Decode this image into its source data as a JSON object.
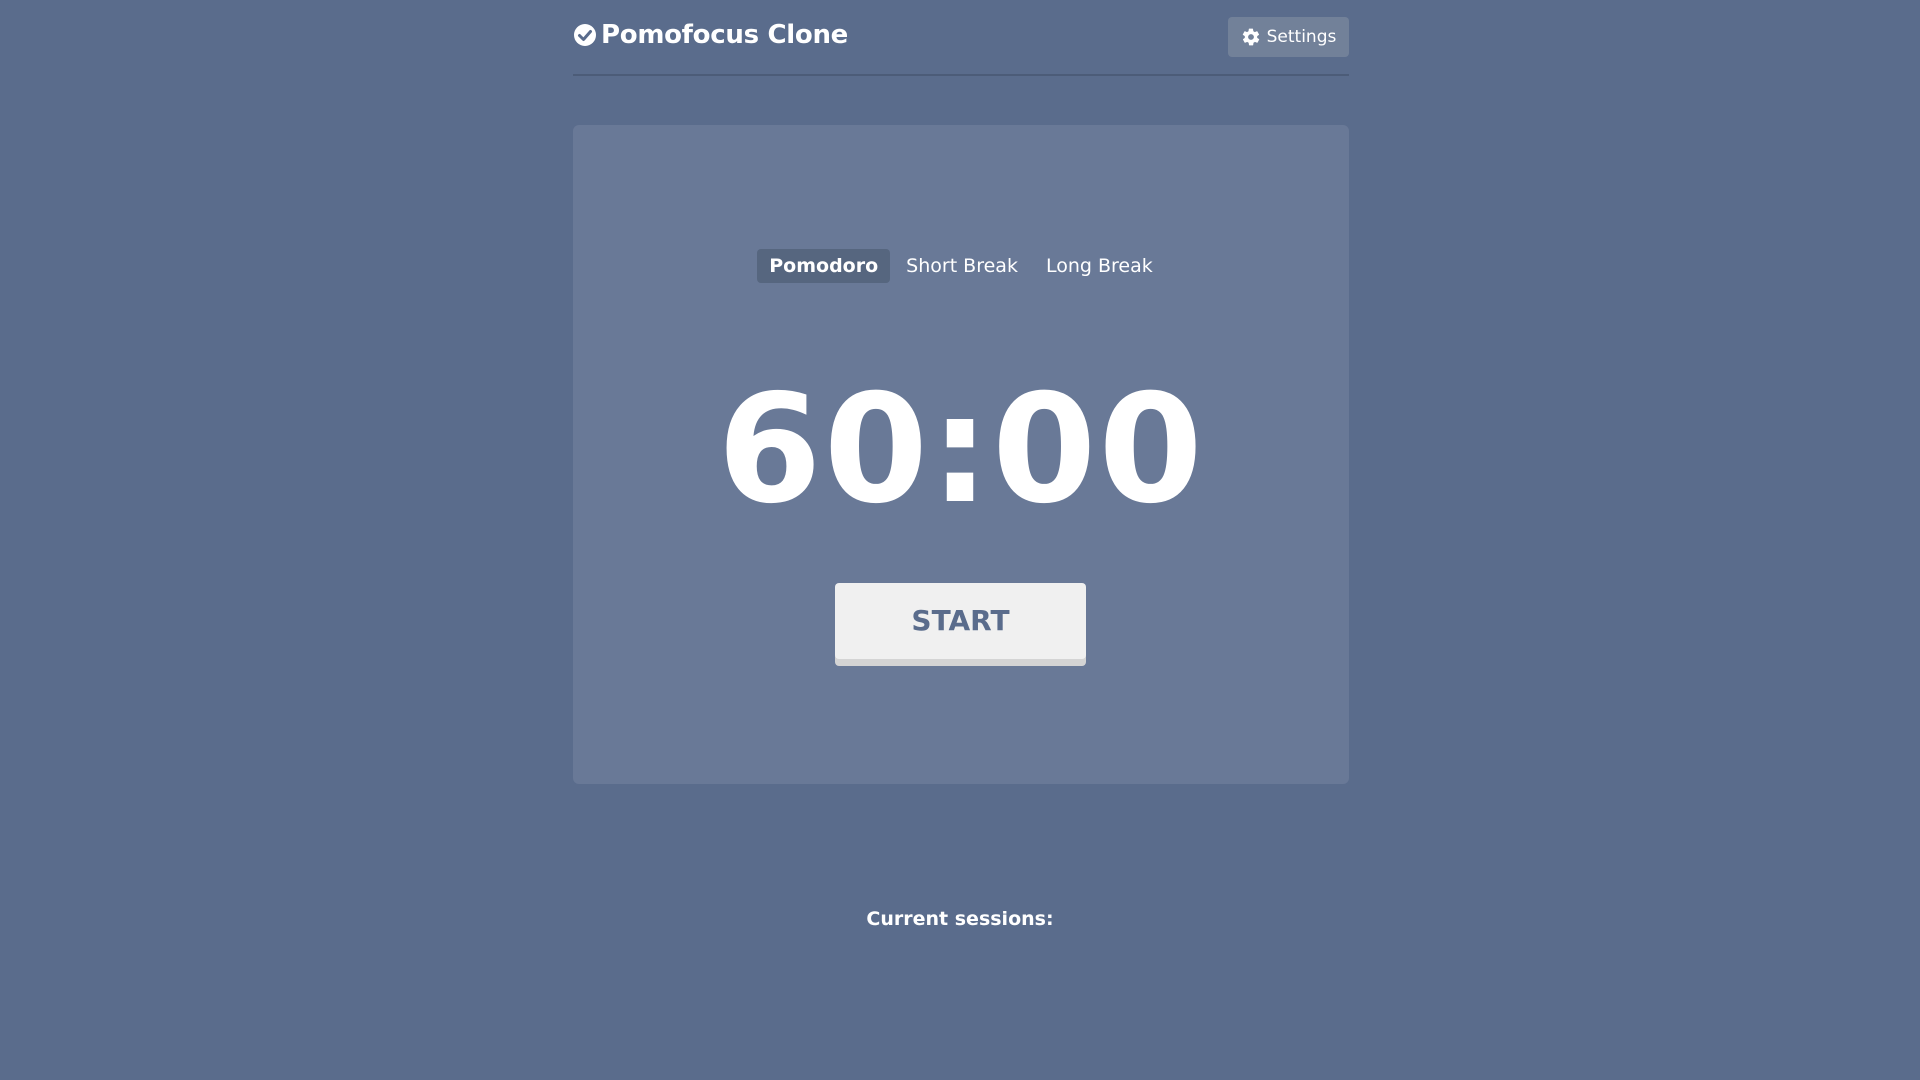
{
  "app": {
    "title": "Pomofocus Clone",
    "logo_icon": "check-circle-icon"
  },
  "header": {
    "settings_label": "Settings",
    "settings_icon": "gear-icon"
  },
  "tabs": [
    {
      "label": "Pomodoro",
      "active": true
    },
    {
      "label": "Short Break",
      "active": false
    },
    {
      "label": "Long Break",
      "active": false
    }
  ],
  "timer": {
    "display": "60:00"
  },
  "controls": {
    "start_label": "START"
  },
  "sessions": {
    "label": "Current sessions:"
  },
  "colors": {
    "background": "#5a6c8c",
    "card": "#697997",
    "active_tab": "#56667f",
    "button": "#f0f0f0",
    "button_text": "#5a6c8c"
  }
}
